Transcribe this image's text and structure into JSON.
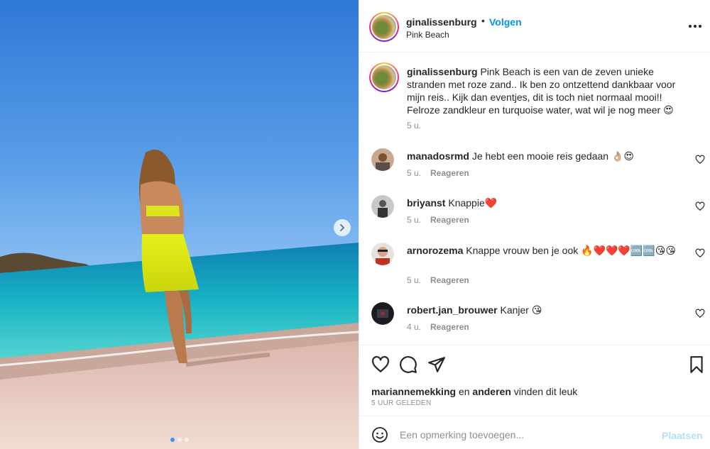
{
  "post": {
    "username": "ginalissenburg",
    "separator": "•",
    "follow_label": "Volgen",
    "location": "Pink Beach",
    "more_icon": "more-horizontal-icon"
  },
  "caption": {
    "username": "ginalissenburg",
    "text": "Pink Beach is een van de zeven unieke stranden met roze zand.. Ik ben zo ontzettend dankbaar voor mijn reis.. Kijk dan eventjes, dit is toch niet normaal mooi!! Felroze zandkleur en turquoise water, wat wil je nog meer 😍",
    "time": "5 u."
  },
  "comments": [
    {
      "username": "manadosrmd",
      "text": "Je hebt een mooie reis gedaan 👌🏼😍",
      "time": "5 u.",
      "reply_label": "Reageren"
    },
    {
      "username": "briyanst",
      "text": "Knappie❤️",
      "time": "5 u.",
      "reply_label": "Reageren"
    },
    {
      "username": "arnorozema",
      "text": "Knappe vrouw ben je ook 🔥❤️❤️❤️🆒🆒😘😘",
      "time": "5 u.",
      "reply_label": "Reageren"
    },
    {
      "username": "robert.jan_brouwer",
      "text": "Kanjer 😘",
      "time": "4 u.",
      "reply_label": "Reageren"
    }
  ],
  "likes": {
    "user": "mariannemekking",
    "connector": "en",
    "others": "anderen",
    "suffix": "vinden dit leuk"
  },
  "post_time": "5 UUR GELEDEN",
  "add_comment": {
    "placeholder": "Een opmerking toevoegen...",
    "post_label": "Plaatsen"
  },
  "carousel": {
    "slides": 3,
    "active": 1
  },
  "colors": {
    "accent": "#0095f6",
    "post_disabled": "#b2dffc",
    "secondary_text": "#8e8e8e"
  }
}
